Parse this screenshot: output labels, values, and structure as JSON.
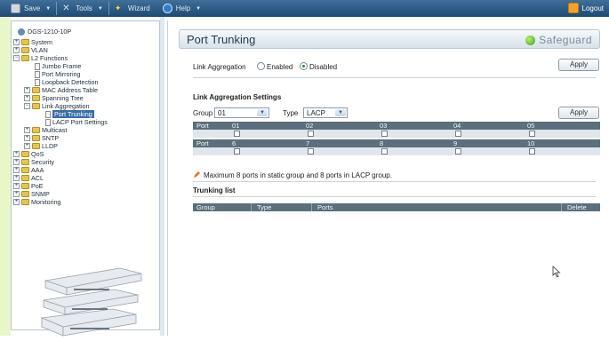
{
  "toolbar": {
    "save": "Save",
    "tools": "Tools",
    "wizard": "Wizard",
    "help": "Help",
    "logout": "Logout"
  },
  "tree": {
    "root": "DGS-1210-10P",
    "items": [
      {
        "label": "System"
      },
      {
        "label": "VLAN"
      },
      {
        "label": "L2 Functions"
      },
      {
        "label": "Jumbo Frame"
      },
      {
        "label": "Port Mirroring"
      },
      {
        "label": "Loopback Detection"
      },
      {
        "label": "MAC Address Table"
      },
      {
        "label": "Spanning Tree"
      },
      {
        "label": "Link Aggregation"
      },
      {
        "label": "Port Trunking"
      },
      {
        "label": "LACP Port Settings"
      },
      {
        "label": "Multicast"
      },
      {
        "label": "SNTP"
      },
      {
        "label": "LLDP"
      },
      {
        "label": "QoS"
      },
      {
        "label": "Security"
      },
      {
        "label": "AAA"
      },
      {
        "label": "ACL"
      },
      {
        "label": "PoE"
      },
      {
        "label": "SNMP"
      },
      {
        "label": "Monitoring"
      }
    ]
  },
  "page": {
    "title": "Port Trunking",
    "safeguard": "Safeguard"
  },
  "link_aggregation": {
    "label": "Link Aggregation",
    "enabled": "Enabled",
    "disabled": "Disabled",
    "selected": "Disabled",
    "apply": "Apply"
  },
  "settings": {
    "heading": "Link Aggregation Settings",
    "group_label": "Group",
    "group_value": "01",
    "type_label": "Type",
    "type_value": "LACP",
    "apply": "Apply",
    "port_label": "Port",
    "row1_ports": [
      "01",
      "02",
      "03",
      "04",
      "05"
    ],
    "row2_ports": [
      "6",
      "7",
      "8",
      "9",
      "10"
    ]
  },
  "note": "Maximum 8 ports in static group and 8 ports in LACP group.",
  "trunking": {
    "heading": "Trunking list",
    "columns": {
      "group": "Group",
      "type": "Type",
      "ports": "Ports",
      "delete": "Delete"
    }
  }
}
